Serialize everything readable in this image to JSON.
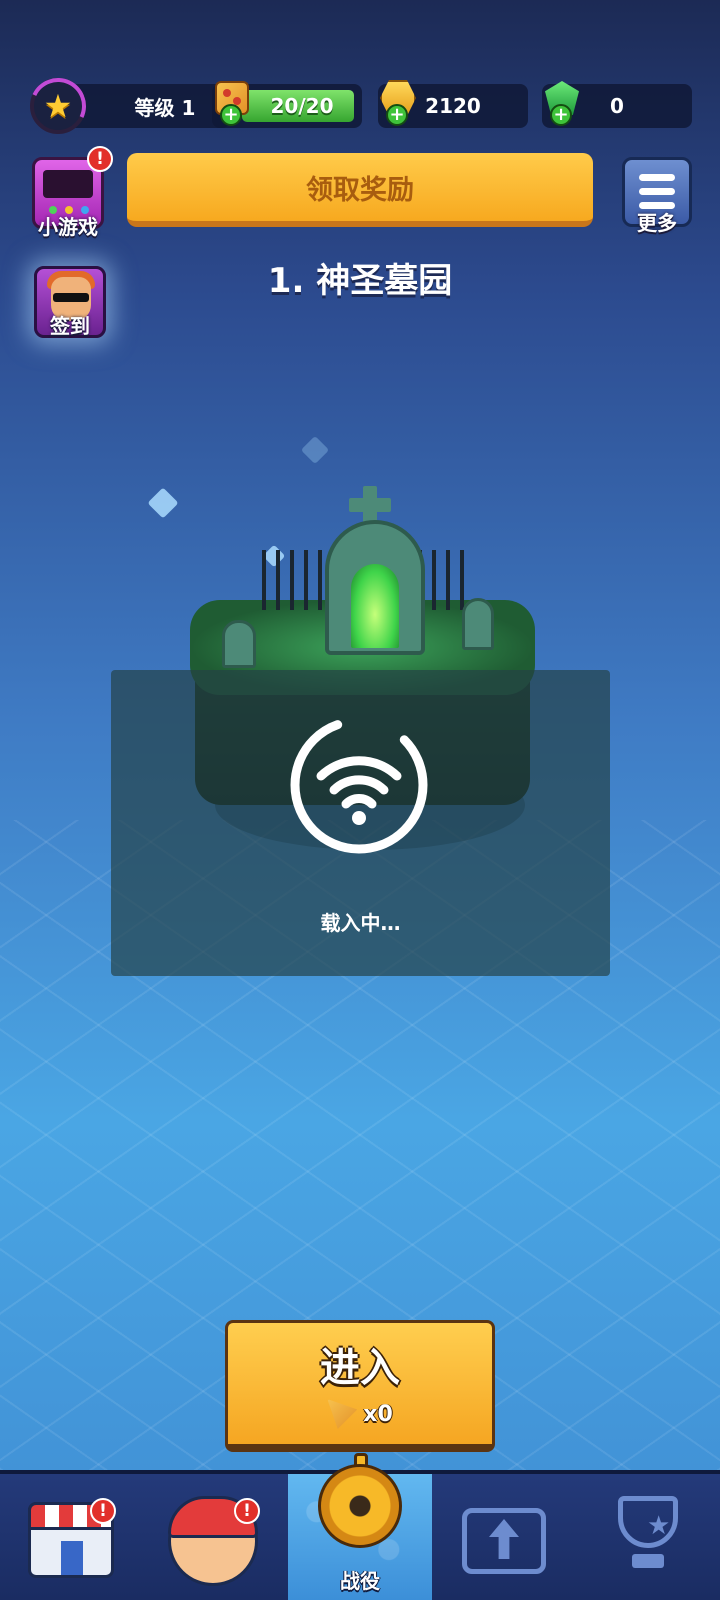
{
  "topbar": {
    "level_label": "等级 1",
    "energy": "20/20",
    "energy_fraction": 1.0,
    "coins": "2120",
    "gems": "0"
  },
  "side": {
    "minigame_label": "小游戏",
    "minigame_alert": "!",
    "checkin_label": "签到",
    "more_label": "更多"
  },
  "claim_label": "领取奖励",
  "stage_title": "1. 神圣墓园",
  "loading_text": "载入中…",
  "enter": {
    "label": "进入",
    "cost": "x0"
  },
  "nav": {
    "shop_alert": "!",
    "hero_alert": "!",
    "campaign_label": "战役",
    "active_tab": "campaign"
  },
  "colors": {
    "gold": "#f7b928",
    "energy_green": "#36a530",
    "alert_red": "#e2302a"
  }
}
